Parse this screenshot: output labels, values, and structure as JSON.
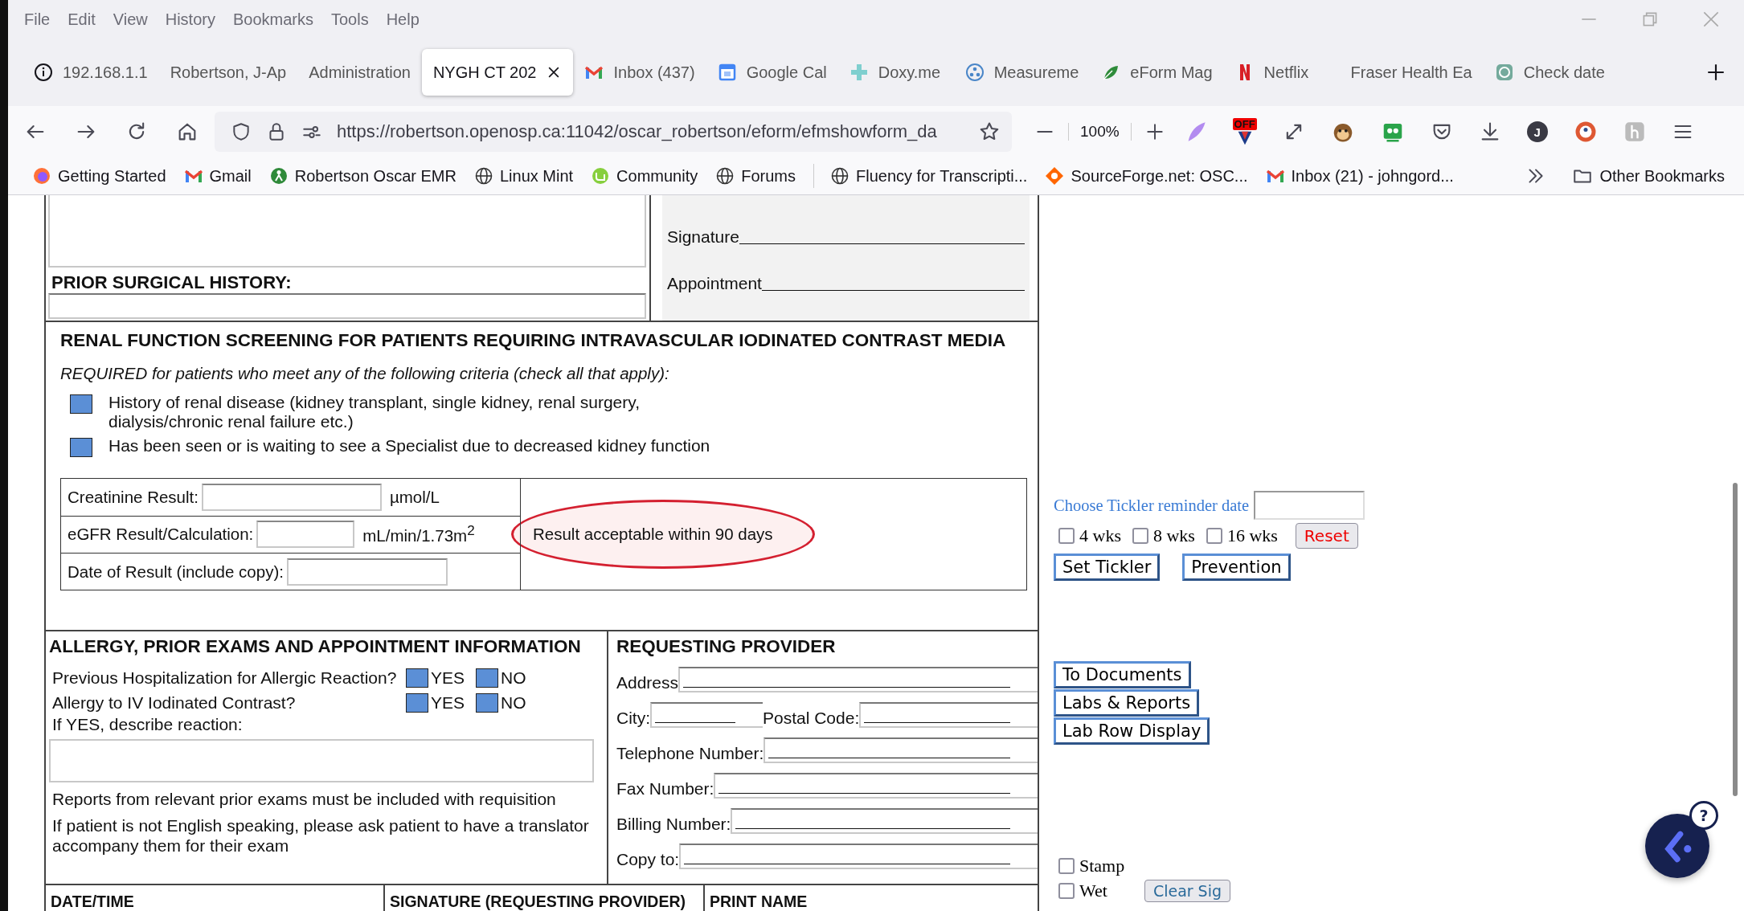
{
  "menu": [
    "File",
    "Edit",
    "View",
    "History",
    "Bookmarks",
    "Tools",
    "Help"
  ],
  "tabs": [
    {
      "label": "192.168.1.1",
      "kind": "info",
      "selected": false
    },
    {
      "label": "Robertson, J-Ap",
      "kind": "none",
      "selected": false
    },
    {
      "label": "Administration",
      "kind": "none",
      "selected": false
    },
    {
      "label": "NYGH CT 202",
      "kind": "none",
      "selected": true
    },
    {
      "label": "Inbox (437)",
      "kind": "mail",
      "selected": false
    },
    {
      "label": "Google Cal",
      "kind": "calendar",
      "selected": false
    },
    {
      "label": "Doxy.me",
      "kind": "cross",
      "selected": false
    },
    {
      "label": "Measureme",
      "kind": "dots",
      "selected": false
    },
    {
      "label": "eForm Mag",
      "kind": "leaf",
      "selected": false
    },
    {
      "label": "Netflix",
      "kind": "netflix",
      "selected": false
    },
    {
      "label": "Fraser Health Ea",
      "kind": "none",
      "selected": false
    },
    {
      "label": "Check date",
      "kind": "knot",
      "selected": false
    }
  ],
  "address": {
    "url": "https://robertson.openosp.ca:11042/oscar_robertson/eform/efmshowform_da",
    "zoom": "100%",
    "extension_badge": "OFF",
    "profile_initial": "J"
  },
  "bookmarks": [
    {
      "label": "Getting Started",
      "kind": "firefox"
    },
    {
      "label": "Gmail",
      "kind": "mail"
    },
    {
      "label": "Robertson Oscar EMR",
      "kind": "oscar"
    },
    {
      "label": "Linux Mint",
      "kind": "globe"
    },
    {
      "label": "Community",
      "kind": "mint"
    },
    {
      "label": "Forums",
      "kind": "globe"
    },
    {
      "label": "Fluency for Transcripti...",
      "kind": "globe"
    },
    {
      "label": "SourceForge.net: OSC...",
      "kind": "sourceforge"
    },
    {
      "label": "Inbox (21) - johngord...",
      "kind": "mail"
    }
  ],
  "other_bookmarks": "Other Bookmarks",
  "form": {
    "top": {
      "prior_surgical_history": "PRIOR SURGICAL HISTORY:",
      "signature": "Signature",
      "appointment": "Appointment"
    },
    "renal": {
      "title": "RENAL FUNCTION SCREENING FOR PATIENTS REQUIRING INTRAVASCULAR IODINATED CONTRAST MEDIA",
      "subtitle": "REQUIRED for patients who meet any of the following criteria (check all that apply):",
      "criteria": [
        {
          "label": "History of renal disease (kidney transplant, single kidney, renal surgery, dialysis/chronic renal failure etc.)",
          "checked": false
        },
        {
          "label": "Has been seen or is waiting to see a Specialist due to decreased kidney function",
          "checked": false
        }
      ],
      "results": [
        {
          "label": "Creatinine Result:",
          "unit": "µmol/L"
        },
        {
          "label": "eGFR Result/Calculation:",
          "unit": "mL/min/1.73m$^{2}$"
        },
        {
          "label": "Date of Result (include copy):"
        }
      ],
      "note": "Result acceptable within 90 days"
    },
    "allergy": {
      "title": "ALLERGY, PRIOR EXAMS AND APPOINTMENT INFORMATION",
      "questions": [
        {
          "label": "Previous Hospitalization for Allergic Reaction?",
          "options": [
            {
              "label": "YES",
              "checked": false
            },
            {
              "label": "NO",
              "checked": false
            }
          ]
        },
        {
          "label": "Allergy to IV Iodinated Contrast?",
          "options": [
            {
              "label": "YES",
              "checked": false
            },
            {
              "label": "NO",
              "checked": false
            }
          ]
        }
      ],
      "describe": "If YES, describe reaction:",
      "notes": [
        "Reports from relevant prior exams must be included with requisition",
        "If patient is not English speaking, please ask patient to have a translator accompany them for their exam"
      ]
    },
    "provider": {
      "title": "REQUESTING PROVIDER",
      "rows": [
        {
          "fields": [
            {
              "label": "Address"
            }
          ]
        },
        {
          "fields": [
            {
              "label": "City:"
            },
            {
              "label": "Postal Code:"
            }
          ]
        },
        {
          "fields": [
            {
              "label": "Telephone Number:"
            }
          ]
        },
        {
          "fields": [
            {
              "label": "Fax Number:"
            }
          ]
        },
        {
          "fields": [
            {
              "label": "Billing Number:"
            }
          ]
        },
        {
          "fields": [
            {
              "label": "Copy to:"
            }
          ]
        }
      ]
    },
    "footer": [
      "DATE/TIME",
      "SIGNATURE  (REQUESTING PROVIDER)",
      "PRINT NAME"
    ]
  },
  "side": {
    "tickler_label": "Choose Tickler reminder date",
    "intervals": [
      {
        "label": "4 wks",
        "checked": false
      },
      {
        "label": "8 wks",
        "checked": false
      },
      {
        "label": "16 wks",
        "checked": false
      }
    ],
    "reset": "Reset",
    "buttons": [
      "Set Tickler",
      "Prevention"
    ],
    "links": [
      "To Documents",
      "Labs & Reports",
      "Lab Row Display"
    ],
    "stamp": {
      "label": "Stamp",
      "checked": false
    },
    "wet": {
      "label": "Wet",
      "checked": false
    },
    "clear_sig": "Clear Sig",
    "help": "?"
  }
}
